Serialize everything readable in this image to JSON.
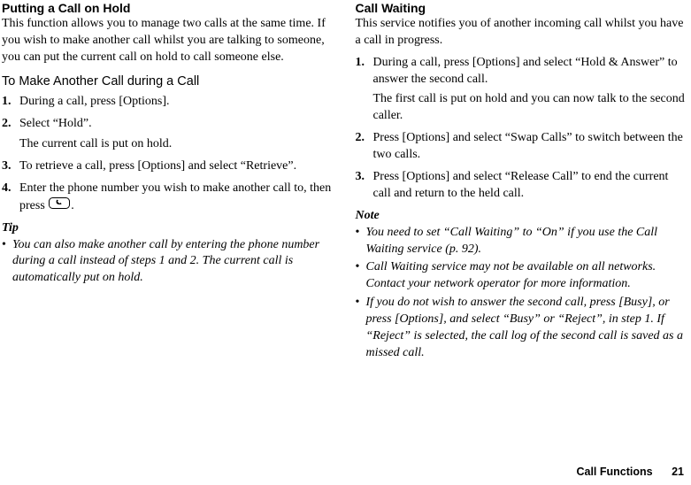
{
  "left": {
    "heading": "Putting a Call on Hold",
    "intro": "This function allows you to manage two calls at the same time. If you wish to make another call whilst you are talking to someone, you can put the current call on hold to call someone else.",
    "sub": "To Make Another Call during a Call",
    "steps": [
      {
        "n": "1.",
        "t1": "During a call, press [Options]."
      },
      {
        "n": "2.",
        "t1": "Select “Hold”.",
        "t2": "The current call is put on hold."
      },
      {
        "n": "3.",
        "t1": "To retrieve a call, press [Options] and select “Retrieve”."
      },
      {
        "n": "4.",
        "t1": "Enter the phone number you wish to make another call to, then press ",
        "after_icon": "."
      }
    ],
    "tip_label": "Tip",
    "tips": [
      "You can also make another call by entering the phone number during a call instead of steps 1 and 2. The current call is automatically put on hold."
    ]
  },
  "right": {
    "heading": "Call Waiting",
    "intro": "This service notifies you of another incoming call whilst you have a call in progress.",
    "steps": [
      {
        "n": "1.",
        "t1": "During a call, press [Options] and select “Hold & Answer” to answer the second call.",
        "t2": "The first call is put on hold and you can now talk to the second caller."
      },
      {
        "n": "2.",
        "t1": "Press [Options] and select “Swap Calls” to switch between the two calls."
      },
      {
        "n": "3.",
        "t1": "Press [Options] and select “Release Call” to end the current call and return to the held call."
      }
    ],
    "note_label": "Note",
    "notes": [
      "You need to set “Call Waiting” to “On” if you use the Call Waiting service (p. 92).",
      "Call Waiting service may not be available on all networks. Contact your network operator for more information.",
      "If you do not wish to answer the second call, press [Busy], or press [Options], and select “Busy” or “Reject”, in step 1. If “Reject” is selected, the call log of the second call is saved as a missed call."
    ]
  },
  "footer": {
    "title": "Call Functions",
    "page": "21"
  }
}
